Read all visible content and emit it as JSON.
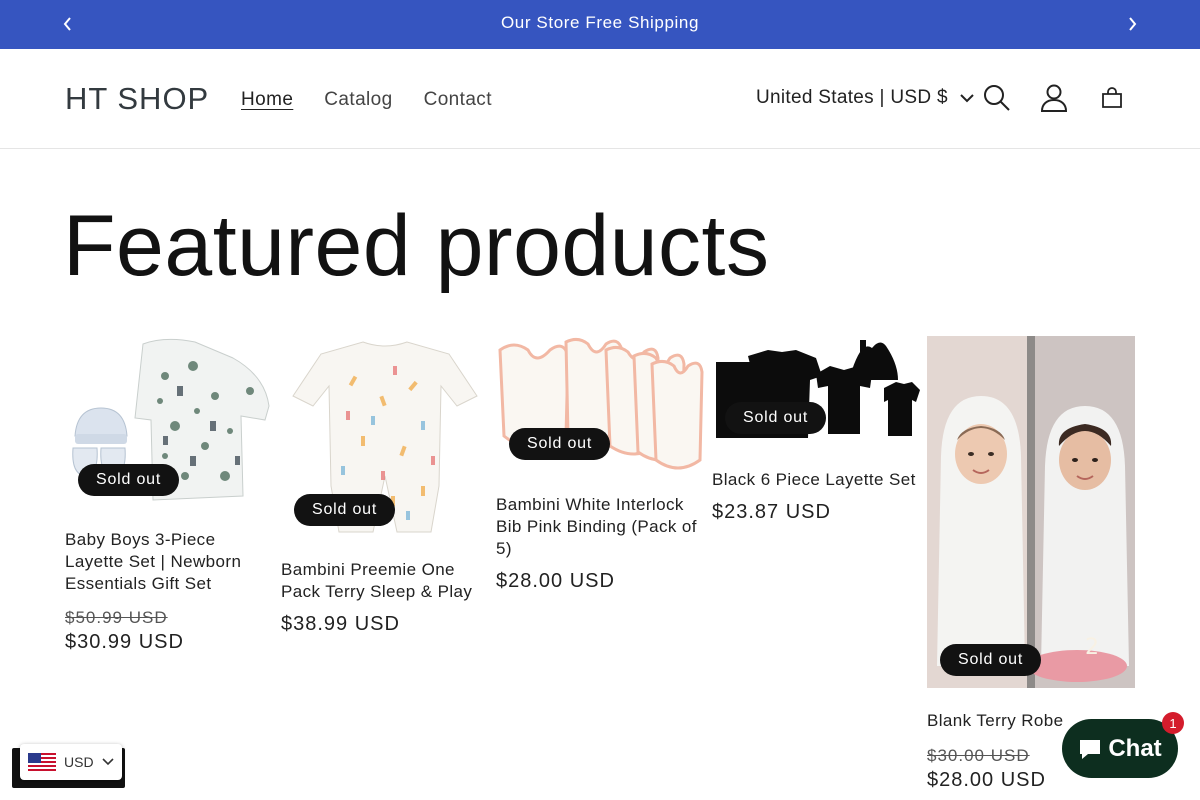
{
  "announcement": {
    "text": "Our Store Free Shipping"
  },
  "header": {
    "logo": "HT SHOP",
    "nav": [
      {
        "label": "Home",
        "active": true
      },
      {
        "label": "Catalog",
        "active": false
      },
      {
        "label": "Contact",
        "active": false
      }
    ],
    "country": "United States | USD $",
    "icons": [
      "search-icon",
      "account-icon",
      "cart-icon"
    ]
  },
  "section": {
    "title": "Featured products"
  },
  "products": [
    {
      "title": "Baby Boys 3-Piece Layette Set | Newborn Essentials Gift Set",
      "compare_price": "$50.99 USD",
      "price": "$30.99 USD",
      "badge": "Sold out"
    },
    {
      "title": "Bambini Preemie One Pack Terry Sleep & Play",
      "compare_price": "",
      "price": "$38.99 USD",
      "badge": "Sold out"
    },
    {
      "title": "Bambini White Interlock Bib Pink Binding (Pack of 5)",
      "compare_price": "",
      "price": "$28.00 USD",
      "badge": "Sold out"
    },
    {
      "title": "Black 6 Piece Layette Set",
      "compare_price": "",
      "price": "$23.87 USD",
      "badge": "Sold out"
    },
    {
      "title": "Blank Terry Robe",
      "compare_price": "$30.00 USD",
      "price": "$28.00 USD",
      "badge": "Sold out"
    }
  ],
  "currency_selector": {
    "label": "USD"
  },
  "chat": {
    "label": "Chat",
    "count": "1"
  },
  "colors": {
    "accent": "#3655c0",
    "badge": "#121212",
    "chat": "#0d2e1f",
    "notification": "#d41c2c"
  }
}
